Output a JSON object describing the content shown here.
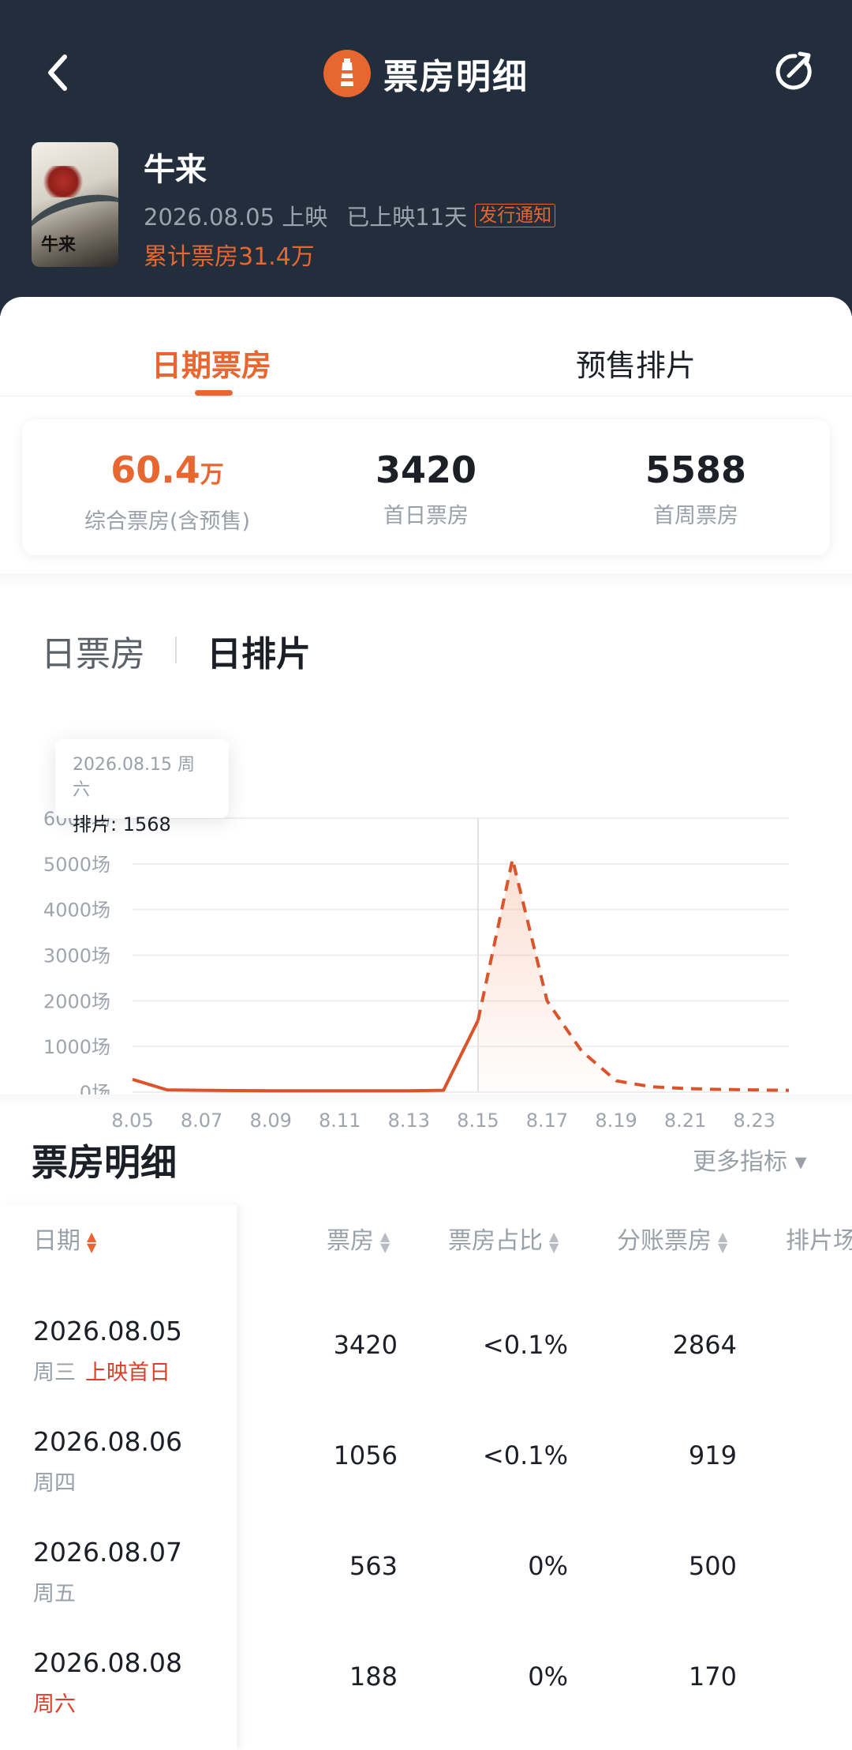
{
  "header": {
    "title": "票房明细",
    "back_icon": "chevron-left-icon",
    "refresh_icon": "share-refresh-icon",
    "logo_icon": "lighthouse-logo-icon"
  },
  "movie": {
    "name": "牛来",
    "poster_text": "牛来",
    "release": "2026.08.05 上映",
    "days_showing": "已上映11天",
    "notice_badge": "发行通知",
    "cumulative_box": "累计票房31.4万"
  },
  "tabs": [
    {
      "label": "日期票房",
      "active": true
    },
    {
      "label": "预售排片",
      "active": false
    }
  ],
  "stats": [
    {
      "value": "60.4",
      "unit": "万",
      "label": "综合票房(含预售)",
      "accent": true
    },
    {
      "value": "3420",
      "unit": "",
      "label": "首日票房",
      "accent": false
    },
    {
      "value": "5588",
      "unit": "",
      "label": "首周票房",
      "accent": false
    }
  ],
  "chart_toggle": {
    "daily_box": "日票房",
    "daily_schedule": "日排片",
    "active": "日排片"
  },
  "tooltip": {
    "date": "2026.08.15 周六",
    "value": "排片: 1568"
  },
  "chart_data": {
    "type": "line",
    "x": [
      "8.05",
      "8.06",
      "8.07",
      "8.08",
      "8.09",
      "8.10",
      "8.11",
      "8.12",
      "8.13",
      "8.14",
      "8.15",
      "8.16",
      "8.17",
      "8.18",
      "8.19",
      "8.20",
      "8.21",
      "8.22",
      "8.23",
      "8.24"
    ],
    "x_tick_labels": [
      "8.05",
      "8.07",
      "8.09",
      "8.11",
      "8.13",
      "8.15",
      "8.17",
      "8.19",
      "8.21",
      "8.23"
    ],
    "y_tick_labels": [
      "0场",
      "1000场",
      "2000场",
      "3000场",
      "4000场",
      "5000场",
      "6000场"
    ],
    "ylim": [
      0,
      6000
    ],
    "grid": true,
    "series": [
      {
        "style": "solid",
        "x": [
          "8.05",
          "8.06",
          "8.07",
          "8.08",
          "8.09",
          "8.10",
          "8.11",
          "8.12",
          "8.13",
          "8.14",
          "8.15"
        ],
        "values": [
          280,
          50,
          40,
          35,
          30,
          30,
          30,
          30,
          30,
          40,
          1568
        ]
      },
      {
        "style": "dashed",
        "x": [
          "8.15",
          "8.16",
          "8.17",
          "8.18",
          "8.19",
          "8.20",
          "8.21",
          "8.22",
          "8.23",
          "8.24"
        ],
        "values": [
          1568,
          5100,
          2000,
          900,
          250,
          120,
          80,
          60,
          50,
          40
        ]
      }
    ],
    "highlight_x": "8.15",
    "line_color": "#d9542b"
  },
  "detail": {
    "title": "票房明细",
    "more_metrics": "更多指标 ▾",
    "columns": [
      "日期",
      "票房",
      "票房占比",
      "分账票房",
      "排片场"
    ],
    "rows": [
      {
        "date": "2026.08.05",
        "weekday": "周三",
        "tag": "上映首日",
        "box": "3420",
        "share": "<0.1%",
        "split": "2864"
      },
      {
        "date": "2026.08.06",
        "weekday": "周四",
        "tag": "",
        "box": "1056",
        "share": "<0.1%",
        "split": "919"
      },
      {
        "date": "2026.08.07",
        "weekday": "周五",
        "tag": "",
        "box": "563",
        "share": "0%",
        "split": "500"
      },
      {
        "date": "2026.08.08",
        "weekday": "周六",
        "tag": "",
        "box": "188",
        "share": "0%",
        "split": "170"
      }
    ]
  },
  "colors": {
    "accent": "#e8662f",
    "header_bg": "#232e3d",
    "weekend_red": "#d8402a"
  }
}
